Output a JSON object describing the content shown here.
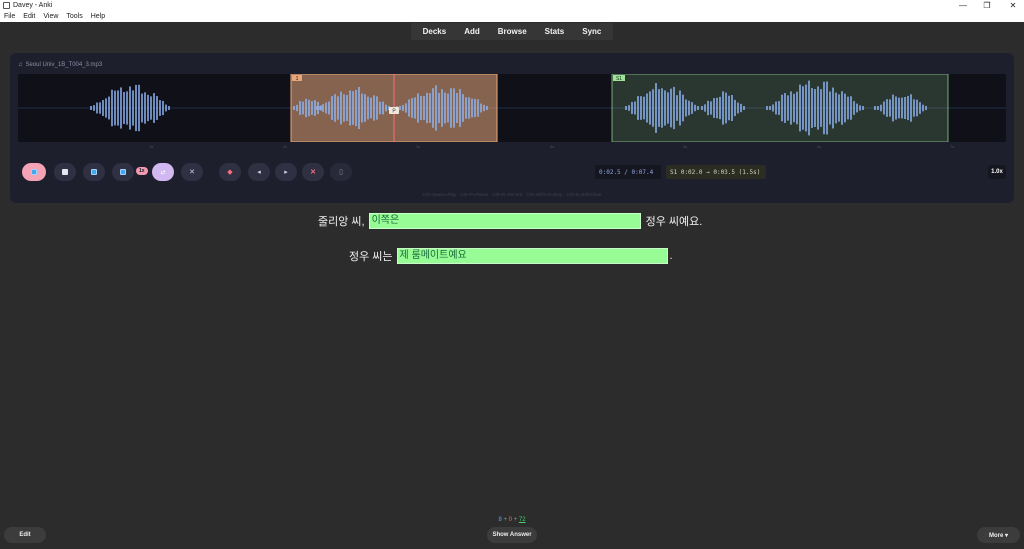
{
  "window": {
    "title": "Davey - Anki",
    "controls": [
      "—",
      "❐",
      "✕"
    ]
  },
  "menu": [
    "File",
    "Edit",
    "View",
    "Tools",
    "Help"
  ],
  "toolbar": [
    "Decks",
    "Add",
    "Browse",
    "Stats",
    "Sync"
  ],
  "player": {
    "file_name": "Seoul Univ_1B_T004_3.mp3",
    "region_a_label": "1",
    "region_b_label": "S1",
    "playhead_label": "P",
    "tick_labels": [
      "1s",
      "2s",
      "3s",
      "4s",
      "5s",
      "6s",
      "7s"
    ],
    "speed_badge": "1x",
    "time_display": "0:02.5 / 0:07.4",
    "segment_display": "S1 0:02.0 → 0:03.5 (1.5s)",
    "rate": "1.0x",
    "shortcut_hint": "Ctrl+Space=Play · Ctrl+P=Pause · Ctrl+R=Record · Ctrl+Shift+S=Stop · Ctrl+E=Edit/Clear",
    "colors": {
      "region_a": "#e8a77a",
      "region_b": "#9fe39a",
      "waveform": "#8fb4f2",
      "playhead": "#ff6b82"
    }
  },
  "card": {
    "line1": {
      "before": "줄리앙 씨,",
      "answer": "이쪽은",
      "after": "정우 씨예요."
    },
    "line2": {
      "before": "정우 씨는",
      "answer": "제 룸메이트예요",
      "after": "."
    }
  },
  "bottom": {
    "new_count": "8",
    "learn_count": "0",
    "review_count": "72",
    "plus": "+",
    "edit_label": "Edit",
    "show_answer_label": "Show Answer",
    "more_label": "More ▾"
  }
}
